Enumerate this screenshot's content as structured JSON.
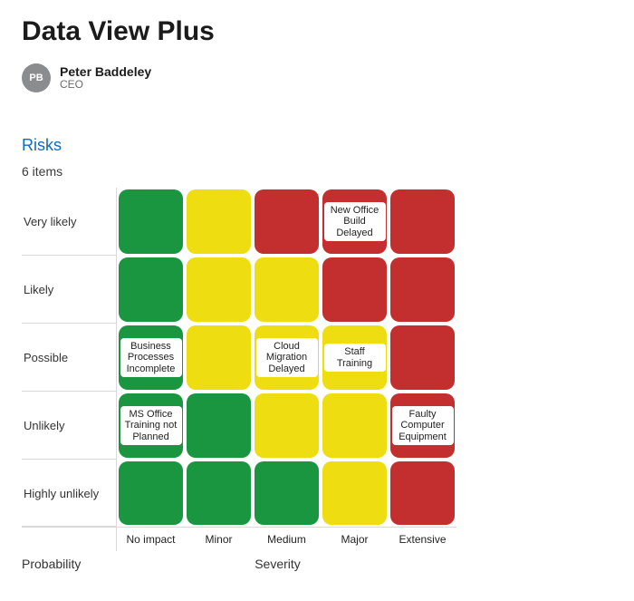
{
  "page": {
    "title": "Data View Plus"
  },
  "author": {
    "initials": "PB",
    "name": "Peter Baddeley",
    "role": "CEO"
  },
  "section": {
    "title": "Risks",
    "count_text": "6 items"
  },
  "axes": {
    "y_label": "Probability",
    "x_label": "Severity",
    "rows": [
      "Very likely",
      "Likely",
      "Possible",
      "Unlikely",
      "Highly unlikely"
    ],
    "cols": [
      "No impact",
      "Minor",
      "Medium",
      "Major",
      "Extensive"
    ]
  },
  "colors": {
    "green": "#1a9641",
    "yellow": "#eddd11",
    "red": "#c32f2f"
  },
  "chart_data": {
    "type": "heatmap",
    "title": "Risks",
    "xlabel": "Severity",
    "ylabel": "Probability",
    "y_categories": [
      "Very likely",
      "Likely",
      "Possible",
      "Unlikely",
      "Highly unlikely"
    ],
    "x_categories": [
      "No impact",
      "Minor",
      "Medium",
      "Major",
      "Extensive"
    ],
    "grid_levels": [
      [
        "green",
        "yellow",
        "red",
        "red",
        "red"
      ],
      [
        "green",
        "yellow",
        "yellow",
        "red",
        "red"
      ],
      [
        "green",
        "yellow",
        "yellow",
        "yellow",
        "red"
      ],
      [
        "green",
        "green",
        "yellow",
        "yellow",
        "red"
      ],
      [
        "green",
        "green",
        "green",
        "yellow",
        "red"
      ]
    ],
    "items": [
      {
        "label": "New Office Build Delayed",
        "row": "Very likely",
        "col": "Major"
      },
      {
        "label": "Business Processes Incomplete",
        "row": "Possible",
        "col": "No impact"
      },
      {
        "label": "Cloud Migration Delayed",
        "row": "Possible",
        "col": "Medium"
      },
      {
        "label": "Staff Training",
        "row": "Possible",
        "col": "Major"
      },
      {
        "label": "MS Office Training not Planned",
        "row": "Unlikely",
        "col": "No impact"
      },
      {
        "label": "Faulty Computer Equipment",
        "row": "Unlikely",
        "col": "Extensive"
      }
    ]
  }
}
